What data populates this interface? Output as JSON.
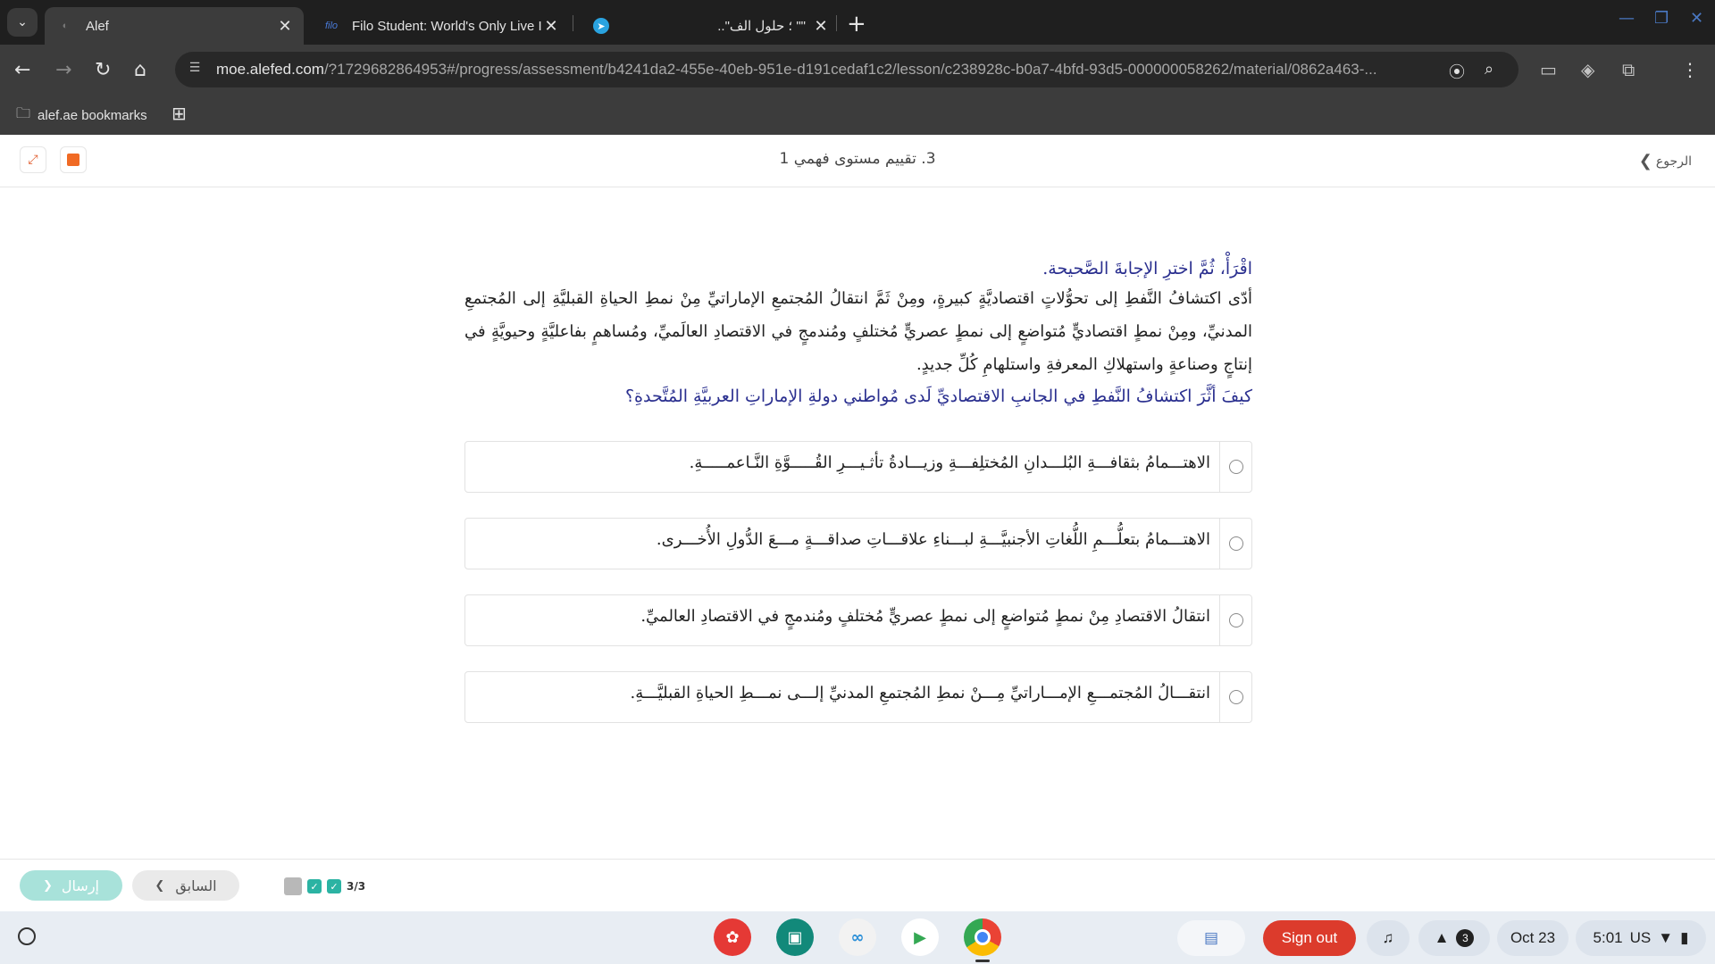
{
  "browser": {
    "tabs": [
      {
        "title": "Alef",
        "active": true,
        "favicon": "alef-icon"
      },
      {
        "title": "Filo Student: World's Only Live I",
        "active": false,
        "favicon": "filo-icon",
        "favicon_text": "filo"
      },
      {
        "title": "\"\" ؛ حلول الف\"..",
        "active": false,
        "favicon": "telegram-icon"
      }
    ],
    "url_host": "moe.alefed.com",
    "url_rest": "/?1729682864953#/progress/assessment/b4241da2-455e-40eb-951e-d191cedaf1c2/lesson/c238928c-b0a7-4bfd-93d5-000000058262/material/0862a463-...",
    "bookmarks_folder": "alef.ae bookmarks"
  },
  "lesson": {
    "title": "3. تقييم مستوى فهمي 1",
    "back_label": "الرجوع"
  },
  "question": {
    "instruction": "اقْرَأْ، ثُمَّ اخترِ الإجابةَ الصَّحيحة.",
    "passage": "أدّى اكتشافُ النَّفطِ إلى تحوُّلاتٍ اقتصاديَّةٍ كبيرةٍ، ومِنْ ثَمَّ انتقالُ المُجتمعِ الإماراتيِّ مِنْ نمطِ الحياةِ القبليَّةِ إلى المُجتمعِ المدنيِّ، ومِنْ نمطٍ اقتصاديٍّ مُتواضعٍ إلى نمطٍ عصريٍّ مُختلفٍ ومُندمجٍ في الاقتصادِ العالَميِّ، ومُساهمٍ بفاعليَّةٍ وحيويَّةٍ في إنتاجٍ وصناعةٍ واستهلاكِ المعرفةِ واستلهامِ كُلِّ جديدٍ.",
    "prompt": "كيفَ أثَّرَ اكتشافُ النَّفطِ في الجانبِ الاقتصاديِّ لَدى مُواطني دولةِ الإماراتِ العربيَّةِ المُتَّحدةِ؟",
    "options": [
      "الاهتـــمامُ بثقافـــةِ البُلـــدانِ المُختلِفـــةِ وزيـــادةُ تأثـيـــرِ القُـــــوَّةِ النَّـاعمـــــةِ.",
      "الاهتـــمامُ بتعلُّـــمِ اللُّغاتِ الأجنبيَّـــةِ لبـــناءِ علاقـــاتِ صداقـــةٍ مـــعَ الدُّولِ الأُخـــرى.",
      "انتقالُ الاقتصادِ مِنْ نمطٍ مُتواضعٍ إلى نمطٍ عصريٍّ مُختلفٍ ومُندمجٍ في الاقتصادِ العالميِّ.",
      "انتقـــالُ المُجتمـــعِ الإمـــاراتيِّ مِـــنْ نمطِ المُجتمعِ المدنيِّ إلـــى نمـــطِ الحياةِ القبليَّـــةِ."
    ]
  },
  "footer": {
    "send_label": "إرسال",
    "prev_label": "السابق",
    "progress_count": "3/3"
  },
  "shelf": {
    "signout_label": "Sign out",
    "notification_count": "3",
    "date": "Oct 23",
    "time": "5:01",
    "locale": "US"
  },
  "colors": {
    "accent_teal": "#2bb3a3",
    "question_blue": "#2a2f8f",
    "signout_red": "#dc3b2c"
  }
}
